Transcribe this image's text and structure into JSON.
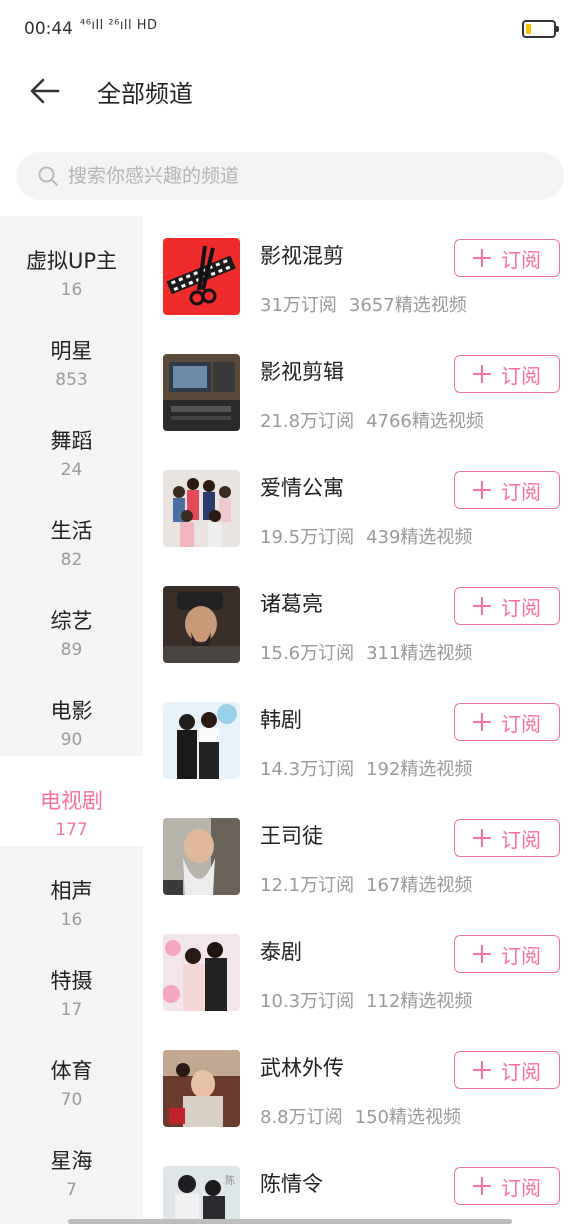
{
  "status_bar": {
    "time": "00:44",
    "signal": "⁴⁶ıll ²⁶ıll HD",
    "battery_level": 0.2,
    "battery_color": "#f5c400"
  },
  "header": {
    "title": "全部频道",
    "back_icon": "arrow-left-icon"
  },
  "search": {
    "placeholder": "搜索你感兴趣的频道",
    "value": ""
  },
  "accent_color": "#fb7299",
  "sidebar": {
    "active_index": 6,
    "items": [
      {
        "name": "虚拟UP主",
        "count": "16"
      },
      {
        "name": "明星",
        "count": "853"
      },
      {
        "name": "舞蹈",
        "count": "24"
      },
      {
        "name": "生活",
        "count": "82"
      },
      {
        "name": "综艺",
        "count": "89"
      },
      {
        "name": "电影",
        "count": "90"
      },
      {
        "name": "电视剧",
        "count": "177"
      },
      {
        "name": "相声",
        "count": "16"
      },
      {
        "name": "特摄",
        "count": "17"
      },
      {
        "name": "体育",
        "count": "70"
      },
      {
        "name": "星海",
        "count": "7"
      }
    ]
  },
  "channels": [
    {
      "name": "影视混剪",
      "subs": "31万订阅",
      "videos": "3657精选视频",
      "button": "订阅"
    },
    {
      "name": "影视剪辑",
      "subs": "21.8万订阅",
      "videos": "4766精选视频",
      "button": "订阅"
    },
    {
      "name": "爱情公寓",
      "subs": "19.5万订阅",
      "videos": "439精选视频",
      "button": "订阅"
    },
    {
      "name": "诸葛亮",
      "subs": "15.6万订阅",
      "videos": "311精选视频",
      "button": "订阅"
    },
    {
      "name": "韩剧",
      "subs": "14.3万订阅",
      "videos": "192精选视频",
      "button": "订阅"
    },
    {
      "name": "王司徒",
      "subs": "12.1万订阅",
      "videos": "167精选视频",
      "button": "订阅"
    },
    {
      "name": "泰剧",
      "subs": "10.3万订阅",
      "videos": "112精选视频",
      "button": "订阅"
    },
    {
      "name": "武林外传",
      "subs": "8.8万订阅",
      "videos": "150精选视频",
      "button": "订阅"
    },
    {
      "name": "陈情令",
      "subs": "",
      "videos": "",
      "button": "订阅"
    }
  ]
}
